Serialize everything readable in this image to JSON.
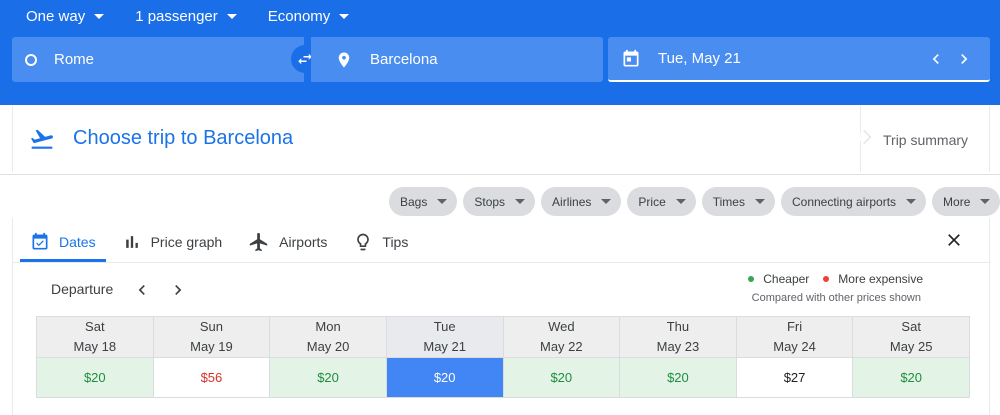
{
  "search": {
    "trip_type": "One way",
    "passengers": "1 passenger",
    "cabin": "Economy",
    "origin": "Rome",
    "destination": "Barcelona",
    "date": "Tue, May 21"
  },
  "choose": {
    "title": "Choose trip to Barcelona",
    "summary": "Trip summary"
  },
  "filters": [
    "Bags",
    "Stops",
    "Airlines",
    "Price",
    "Times",
    "Connecting airports",
    "More"
  ],
  "tabs": {
    "dates": "Dates",
    "price_graph": "Price graph",
    "airports": "Airports",
    "tips": "Tips"
  },
  "calendar": {
    "departure_label": "Departure",
    "legend_cheaper": "Cheaper",
    "legend_expensive": "More expensive",
    "compared_note": "Compared with other prices shown",
    "days": [
      {
        "dow": "Sat",
        "date": "May 18",
        "price": "$20",
        "status": "cheap"
      },
      {
        "dow": "Sun",
        "date": "May 19",
        "price": "$56",
        "status": "exp"
      },
      {
        "dow": "Mon",
        "date": "May 20",
        "price": "$20",
        "status": "cheap"
      },
      {
        "dow": "Tue",
        "date": "May 21",
        "price": "$20",
        "status": "selected"
      },
      {
        "dow": "Wed",
        "date": "May 22",
        "price": "$20",
        "status": "cheap"
      },
      {
        "dow": "Thu",
        "date": "May 23",
        "price": "$20",
        "status": "cheap"
      },
      {
        "dow": "Fri",
        "date": "May 24",
        "price": "$27",
        "status": "neutral"
      },
      {
        "dow": "Sat",
        "date": "May 25",
        "price": "$20",
        "status": "cheap"
      }
    ]
  },
  "colors": {
    "header_blue": "#1a6ee8",
    "accent": "#1a73e8",
    "cheaper": "#1e8e3e",
    "expensive": "#d93025",
    "selected": "#4285f4"
  }
}
